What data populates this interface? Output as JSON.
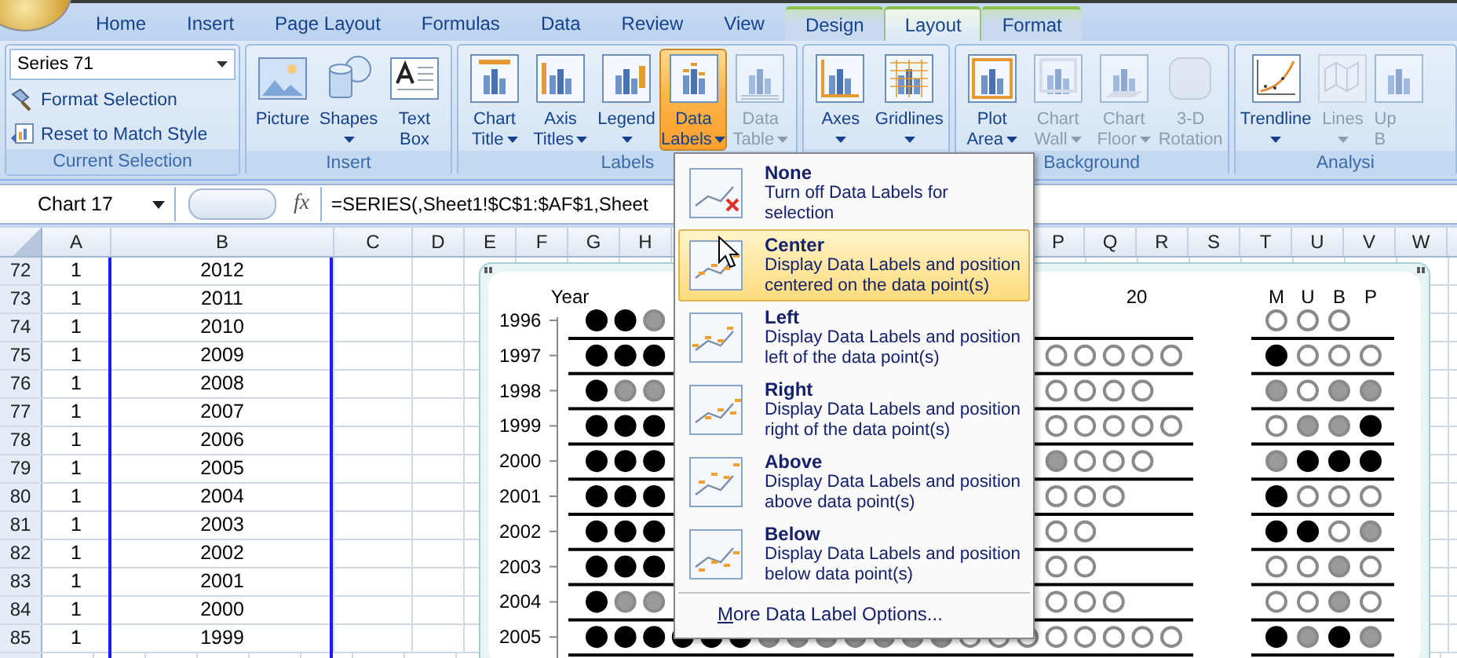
{
  "tabs": [
    {
      "label": "Home",
      "selected": false,
      "contextual": false
    },
    {
      "label": "Insert",
      "selected": false,
      "contextual": false
    },
    {
      "label": "Page Layout",
      "selected": false,
      "contextual": false
    },
    {
      "label": "Formulas",
      "selected": false,
      "contextual": false
    },
    {
      "label": "Data",
      "selected": false,
      "contextual": false
    },
    {
      "label": "Review",
      "selected": false,
      "contextual": false
    },
    {
      "label": "View",
      "selected": false,
      "contextual": false
    },
    {
      "label": "Design",
      "selected": false,
      "contextual": true
    },
    {
      "label": "Layout",
      "selected": true,
      "contextual": true
    },
    {
      "label": "Format",
      "selected": false,
      "contextual": true
    }
  ],
  "ribbon": [
    {
      "kind": "selection",
      "label": "Current Selection",
      "dropdown": "Series 71",
      "items": [
        "Format Selection",
        "Reset to Match Style"
      ]
    },
    {
      "kind": "buttons",
      "label": "Insert",
      "buttons": [
        {
          "lines": [
            "Picture"
          ],
          "dropdown": false,
          "disabled": false,
          "pressed": false
        },
        {
          "lines": [
            "Shapes"
          ],
          "dropdown": true,
          "disabled": false,
          "pressed": false
        },
        {
          "lines": [
            "Text",
            "Box"
          ],
          "dropdown": false,
          "disabled": false,
          "pressed": false
        }
      ]
    },
    {
      "kind": "buttons",
      "label": "Labels",
      "buttons": [
        {
          "lines": [
            "Chart",
            "Title"
          ],
          "dropdown": true,
          "disabled": false,
          "pressed": false
        },
        {
          "lines": [
            "Axis",
            "Titles"
          ],
          "dropdown": true,
          "disabled": false,
          "pressed": false
        },
        {
          "lines": [
            "Legend"
          ],
          "dropdown": true,
          "disabled": false,
          "pressed": false
        },
        {
          "lines": [
            "Data",
            "Labels"
          ],
          "dropdown": true,
          "disabled": false,
          "pressed": true
        },
        {
          "lines": [
            "Data",
            "Table"
          ],
          "dropdown": true,
          "disabled": true,
          "pressed": false
        }
      ]
    },
    {
      "kind": "buttons",
      "buttons": [
        {
          "lines": [
            "Axes"
          ],
          "dropdown": true,
          "disabled": false,
          "pressed": false
        },
        {
          "lines": [
            "Gridlines"
          ],
          "dropdown": true,
          "disabled": false,
          "pressed": false
        }
      ]
    },
    {
      "kind": "buttons",
      "label": "Background",
      "buttons": [
        {
          "lines": [
            "Plot",
            "Area"
          ],
          "dropdown": true,
          "disabled": false,
          "pressed": false
        },
        {
          "lines": [
            "Chart",
            "Wall"
          ],
          "dropdown": true,
          "disabled": true,
          "pressed": false
        },
        {
          "lines": [
            "Chart",
            "Floor"
          ],
          "dropdown": true,
          "disabled": true,
          "pressed": false
        },
        {
          "lines": [
            "3-D",
            "Rotation"
          ],
          "dropdown": false,
          "disabled": true,
          "pressed": false
        }
      ]
    },
    {
      "kind": "buttons",
      "label": "Analysi",
      "buttons": [
        {
          "lines": [
            "Trendline"
          ],
          "dropdown": true,
          "disabled": false,
          "pressed": false
        },
        {
          "lines": [
            "Lines"
          ],
          "dropdown": true,
          "disabled": true,
          "pressed": false
        },
        {
          "lines": [
            "Up",
            "B"
          ],
          "dropdown": false,
          "disabled": true,
          "pressed": false
        }
      ]
    }
  ],
  "formula_bar": {
    "name_box": "Chart 17",
    "function_button": "fx",
    "formula": "=SERIES(,Sheet1!$C$1:$AF$1,Sheet"
  },
  "columns": [
    "A",
    "B",
    "C",
    "D",
    "E",
    "F",
    "G",
    "H",
    "P",
    "Q",
    "R",
    "S",
    "T",
    "U",
    "V",
    "W"
  ],
  "rows": [
    {
      "number": "72",
      "a": "1",
      "b": "2012"
    },
    {
      "number": "73",
      "a": "1",
      "b": "2011"
    },
    {
      "number": "74",
      "a": "1",
      "b": "2010"
    },
    {
      "number": "75",
      "a": "1",
      "b": "2009"
    },
    {
      "number": "76",
      "a": "1",
      "b": "2008"
    },
    {
      "number": "77",
      "a": "1",
      "b": "2007"
    },
    {
      "number": "78",
      "a": "1",
      "b": "2006"
    },
    {
      "number": "79",
      "a": "1",
      "b": "2005"
    },
    {
      "number": "80",
      "a": "1",
      "b": "2004"
    },
    {
      "number": "81",
      "a": "1",
      "b": "2003"
    },
    {
      "number": "82",
      "a": "1",
      "b": "2002"
    },
    {
      "number": "83",
      "a": "1",
      "b": "2001"
    },
    {
      "number": "84",
      "a": "1",
      "b": "2000"
    },
    {
      "number": "85",
      "a": "1",
      "b": "1999"
    }
  ],
  "chart": {
    "column_header": "Year",
    "middle_header": "20",
    "group_headers": [
      "M",
      "U",
      "B",
      "P"
    ],
    "rows": [
      {
        "year": "1996",
        "left": [
          {
            "kind": "filled"
          },
          {
            "kind": "filled"
          },
          {
            "kind": "grey"
          }
        ],
        "right": [],
        "group": [
          {
            "kind": "empty"
          },
          {
            "kind": "empty"
          },
          {
            "kind": "empty"
          }
        ]
      },
      {
        "year": "1997",
        "left": [
          {
            "kind": "filled"
          },
          {
            "kind": "filled"
          },
          {
            "kind": "filled"
          }
        ],
        "right": [
          {
            "kind": "empty"
          },
          {
            "kind": "empty"
          },
          {
            "kind": "empty"
          },
          {
            "kind": "empty"
          },
          {
            "kind": "empty"
          }
        ],
        "group": [
          {
            "kind": "filled"
          },
          {
            "kind": "empty"
          },
          {
            "kind": "empty"
          },
          {
            "kind": "empty"
          }
        ]
      },
      {
        "year": "1998",
        "left": [
          {
            "kind": "filled"
          },
          {
            "kind": "grey"
          },
          {
            "kind": "grey"
          }
        ],
        "right": [
          {
            "kind": "empty"
          },
          {
            "kind": "empty"
          },
          {
            "kind": "empty"
          },
          {
            "kind": "empty"
          }
        ],
        "group": [
          {
            "kind": "grey"
          },
          {
            "kind": "empty"
          },
          {
            "kind": "grey"
          },
          {
            "kind": "grey"
          }
        ]
      },
      {
        "year": "1999",
        "left": [
          {
            "kind": "filled"
          },
          {
            "kind": "filled"
          },
          {
            "kind": "filled"
          }
        ],
        "right": [
          {
            "kind": "empty"
          },
          {
            "kind": "empty"
          },
          {
            "kind": "empty"
          },
          {
            "kind": "empty"
          },
          {
            "kind": "empty"
          }
        ],
        "group": [
          {
            "kind": "empty"
          },
          {
            "kind": "grey"
          },
          {
            "kind": "grey"
          },
          {
            "kind": "filled"
          }
        ]
      },
      {
        "year": "2000",
        "left": [
          {
            "kind": "filled"
          },
          {
            "kind": "filled"
          },
          {
            "kind": "filled"
          }
        ],
        "right": [
          {
            "kind": "grey"
          },
          {
            "kind": "empty"
          },
          {
            "kind": "empty"
          },
          {
            "kind": "empty"
          }
        ],
        "group": [
          {
            "kind": "grey"
          },
          {
            "kind": "filled"
          },
          {
            "kind": "filled"
          },
          {
            "kind": "filled"
          }
        ]
      },
      {
        "year": "2001",
        "left": [
          {
            "kind": "filled"
          },
          {
            "kind": "filled"
          },
          {
            "kind": "filled"
          }
        ],
        "right": [
          {
            "kind": "empty"
          },
          {
            "kind": "empty"
          },
          {
            "kind": "empty"
          }
        ],
        "group": [
          {
            "kind": "filled"
          },
          {
            "kind": "empty"
          },
          {
            "kind": "empty"
          },
          {
            "kind": "empty"
          }
        ]
      },
      {
        "year": "2002",
        "left": [
          {
            "kind": "filled"
          },
          {
            "kind": "filled"
          },
          {
            "kind": "filled"
          }
        ],
        "right": [
          {
            "kind": "empty"
          },
          {
            "kind": "empty"
          }
        ],
        "group": [
          {
            "kind": "filled"
          },
          {
            "kind": "filled"
          },
          {
            "kind": "empty"
          },
          {
            "kind": "grey"
          }
        ]
      },
      {
        "year": "2003",
        "left": [
          {
            "kind": "filled"
          },
          {
            "kind": "filled"
          },
          {
            "kind": "filled"
          }
        ],
        "right": [
          {
            "kind": "empty"
          },
          {
            "kind": "empty"
          }
        ],
        "group": [
          {
            "kind": "empty"
          },
          {
            "kind": "empty"
          },
          {
            "kind": "grey"
          },
          {
            "kind": "empty"
          }
        ]
      },
      {
        "year": "2004",
        "left": [
          {
            "kind": "filled"
          },
          {
            "kind": "grey"
          },
          {
            "kind": "grey"
          }
        ],
        "right": [
          {
            "kind": "empty"
          },
          {
            "kind": "empty"
          },
          {
            "kind": "empty"
          }
        ],
        "group": [
          {
            "kind": "empty"
          },
          {
            "kind": "empty"
          },
          {
            "kind": "grey"
          },
          {
            "kind": "empty"
          }
        ]
      },
      {
        "year": "2005",
        "left": [
          {
            "kind": "filled"
          },
          {
            "kind": "filled"
          },
          {
            "kind": "filled"
          },
          {
            "kind": "filled"
          },
          {
            "kind": "filled"
          },
          {
            "kind": "filled"
          },
          {
            "kind": "grey"
          },
          {
            "kind": "grey"
          },
          {
            "kind": "grey"
          },
          {
            "kind": "grey"
          },
          {
            "kind": "grey"
          },
          {
            "kind": "grey"
          },
          {
            "kind": "grey"
          },
          {
            "kind": "empty"
          },
          {
            "kind": "empty"
          },
          {
            "kind": "empty"
          },
          {
            "kind": "empty"
          },
          {
            "kind": "empty"
          },
          {
            "kind": "empty"
          },
          {
            "kind": "empty"
          },
          {
            "kind": "empty"
          }
        ],
        "right": [],
        "group": [
          {
            "kind": "filled"
          },
          {
            "kind": "grey"
          },
          {
            "kind": "filled"
          },
          {
            "kind": "grey"
          }
        ]
      }
    ]
  },
  "menu": {
    "items": [
      {
        "title": "None",
        "description": "Turn off Data Labels for\nselection",
        "highlighted": false
      },
      {
        "title": "Center",
        "description": "Display Data Labels and position\ncentered on the data point(s)",
        "highlighted": true
      },
      {
        "title": "Left",
        "description": "Display Data Labels and position\nleft of the data point(s)",
        "highlighted": false
      },
      {
        "title": "Right",
        "description": "Display Data Labels and position\nright of the data point(s)",
        "highlighted": false
      },
      {
        "title": "Above",
        "description": "Display Data Labels and position\nabove data point(s)",
        "highlighted": false
      },
      {
        "title": "Below",
        "description": "Display Data Labels and position\nbelow data point(s)",
        "highlighted": false
      }
    ],
    "footer": "More Data Label Options..."
  }
}
